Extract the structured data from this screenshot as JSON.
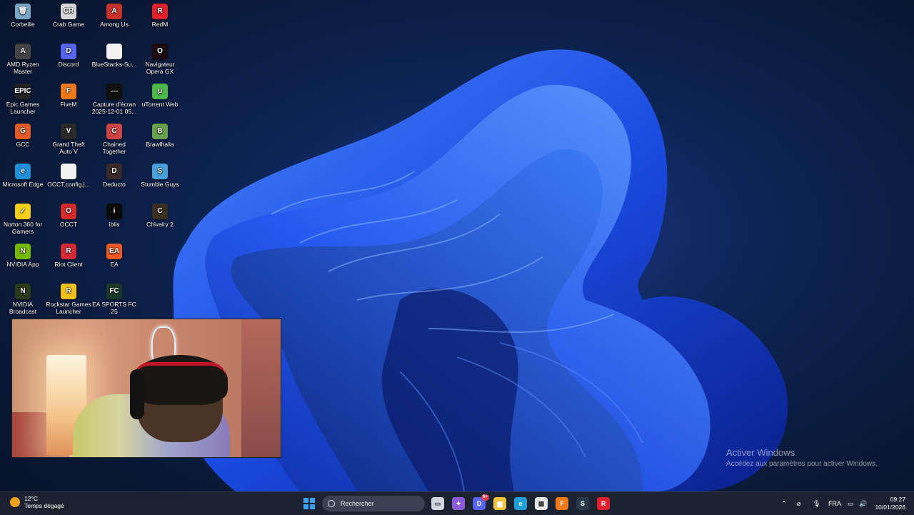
{
  "desktop": {
    "icons": [
      {
        "label": "Corbeille",
        "icon": "recycle-bin-icon",
        "color": "#7aa7c7",
        "glyph": "🗑"
      },
      {
        "label": "Crab Game",
        "icon": "crab-game-icon",
        "color": "#d8d8d8",
        "glyph": "CR"
      },
      {
        "label": "Among Us",
        "icon": "among-us-icon",
        "color": "#c8302a",
        "glyph": "A"
      },
      {
        "label": "RedM",
        "icon": "redm-icon",
        "color": "#e0202a",
        "glyph": "R"
      },
      {
        "label": "AMD Ryzen Master",
        "icon": "amd-ryzen-icon",
        "color": "#444",
        "glyph": "A"
      },
      {
        "label": "Discord",
        "icon": "discord-icon",
        "color": "#5865f2",
        "glyph": "D"
      },
      {
        "label": "BlueStacks-Su...",
        "icon": "file-icon",
        "color": "#f2f2f2",
        "glyph": ""
      },
      {
        "label": "Navigateur Opera GX",
        "icon": "opera-gx-icon",
        "color": "#1a0a12",
        "glyph": "O"
      },
      {
        "label": "Epic Games Launcher",
        "icon": "epic-games-icon",
        "color": "#222",
        "glyph": "EPIC"
      },
      {
        "label": "FiveM",
        "icon": "fivem-icon",
        "color": "#f07a1a",
        "glyph": "F"
      },
      {
        "label": "Capture d'écran 2025-12-01 05...",
        "icon": "screenshot-file-icon",
        "color": "#101010",
        "glyph": "—"
      },
      {
        "label": "uTorrent Web",
        "icon": "utorrent-icon",
        "color": "#4cb848",
        "glyph": "μ"
      },
      {
        "label": "GCC",
        "icon": "gcc-icon",
        "color": "#e35a26",
        "glyph": "G"
      },
      {
        "label": "Grand Theft Auto V",
        "icon": "gta-icon",
        "color": "#2a2a2a",
        "glyph": "V"
      },
      {
        "label": "Chained Together",
        "icon": "chained-together-icon",
        "color": "#c44",
        "glyph": "C"
      },
      {
        "label": "Brawlhalla",
        "icon": "brawlhalla-icon",
        "color": "#6aa04a",
        "glyph": "B"
      },
      {
        "label": "Microsoft Edge",
        "icon": "edge-icon",
        "color": "#1f8fd8",
        "glyph": "e"
      },
      {
        "label": "OCCT.config.j...",
        "icon": "file-icon",
        "color": "#f2f2f2",
        "glyph": ""
      },
      {
        "label": "Deducto",
        "icon": "deducto-icon",
        "color": "#3a2a2a",
        "glyph": "D"
      },
      {
        "label": "Stumble Guys",
        "icon": "stumble-guys-icon",
        "color": "#4aa0d8",
        "glyph": "S"
      },
      {
        "label": "Norton 360 for Gamers",
        "icon": "norton-icon",
        "color": "#f4d01a",
        "glyph": "✓"
      },
      {
        "label": "OCCT",
        "icon": "occt-icon",
        "color": "#d42a2a",
        "glyph": "O"
      },
      {
        "label": "iblis",
        "icon": "iblis-icon",
        "color": "#0a0a0a",
        "glyph": "i"
      },
      {
        "label": "Chivalry 2",
        "icon": "chivalry-icon",
        "color": "#3a3020",
        "glyph": "C"
      },
      {
        "label": "NVIDIA App",
        "icon": "nvidia-icon",
        "color": "#76b900",
        "glyph": "N"
      },
      {
        "label": "Riot Client",
        "icon": "riot-client-icon",
        "color": "#d32a36",
        "glyph": "R"
      },
      {
        "label": "EA",
        "icon": "ea-icon",
        "color": "#f05a20",
        "glyph": "EA"
      },
      {
        "label": "",
        "icon": "empty",
        "color": "transparent",
        "glyph": ""
      },
      {
        "label": "NVIDIA Broadcast",
        "icon": "nvidia-broadcast-icon",
        "color": "#2a3a1a",
        "glyph": "N"
      },
      {
        "label": "Rockstar Games Launcher",
        "icon": "rockstar-icon",
        "color": "#f4c01a",
        "glyph": "R"
      },
      {
        "label": "EA SPORTS FC 25",
        "icon": "ea-fc-icon",
        "color": "#1a3a2a",
        "glyph": "FC"
      }
    ],
    "watermark": {
      "title": "Activer Windows",
      "subtitle": "Accédez aux paramètres pour activer Windows."
    }
  },
  "taskbar": {
    "weather": {
      "temp": "12°C",
      "desc": "Temps dégagé"
    },
    "search_placeholder": "Rechercher",
    "apps": [
      {
        "name": "task-view-icon",
        "color": "#cfd6e0",
        "glyph": "▭"
      },
      {
        "name": "copilot-icon",
        "color": "#8a5ad8",
        "glyph": "✦"
      },
      {
        "name": "discord-taskbar-icon",
        "color": "#5865f2",
        "glyph": "D"
      },
      {
        "name": "file-explorer-icon",
        "color": "#f2c23a",
        "glyph": "▆"
      },
      {
        "name": "edge-taskbar-icon",
        "color": "#1f9fd8",
        "glyph": "e"
      },
      {
        "name": "store-icon",
        "color": "#e8e8e8",
        "glyph": "▦"
      },
      {
        "name": "fivem-taskbar-icon",
        "color": "#f07a1a",
        "glyph": "F"
      },
      {
        "name": "steam-icon",
        "color": "#2a3a4a",
        "glyph": "S"
      },
      {
        "name": "redm-taskbar-icon",
        "color": "#e0202a",
        "glyph": "R"
      }
    ],
    "discord_badge": "9+",
    "language": "FRA",
    "time": "09:27",
    "date": "10/01/2026"
  }
}
